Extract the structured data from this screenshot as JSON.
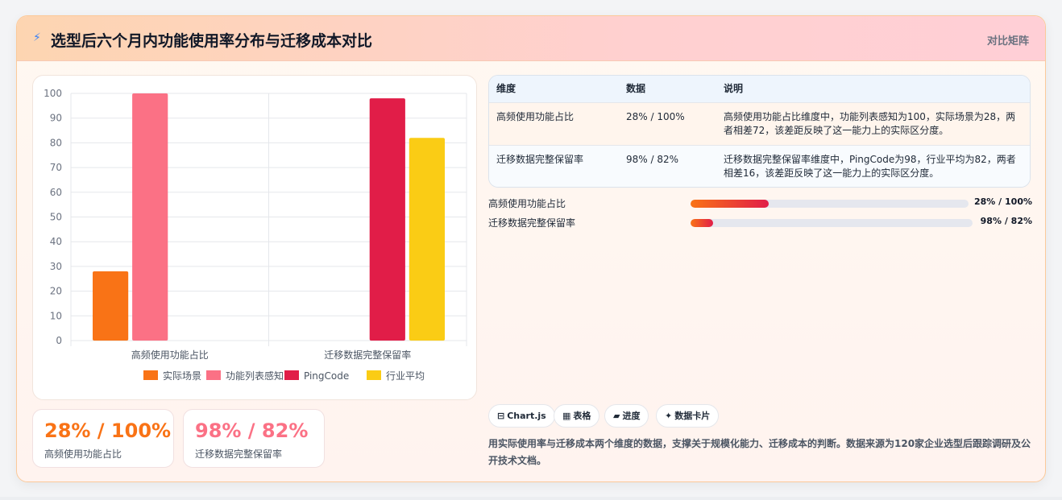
{
  "header": {
    "icon": "bolt-icon",
    "title": "选型后六个月内功能使用率分布与迁移成本对比",
    "tag": "对比矩阵"
  },
  "chart_data": {
    "type": "bar",
    "categories": [
      "高频使用功能占比",
      "迁移数据完整保留率"
    ],
    "series": [
      {
        "name": "实际场景",
        "color": "#f97316",
        "values": [
          28,
          null
        ]
      },
      {
        "name": "功能列表感知",
        "color": "#fb7185",
        "values": [
          100,
          null
        ]
      },
      {
        "name": "PingCode",
        "color": "#e11d48",
        "values": [
          null,
          98
        ]
      },
      {
        "name": "行业平均",
        "color": "#facc15",
        "values": [
          null,
          82
        ]
      }
    ],
    "yticks": [
      0,
      10,
      20,
      30,
      40,
      50,
      60,
      70,
      80,
      90,
      100
    ],
    "ylim": [
      0,
      100
    ],
    "grid": true,
    "legend": "bottom"
  },
  "stats": [
    {
      "value": "28% / 100%",
      "label": "高频使用功能占比",
      "color": "#f97316"
    },
    {
      "value": "98% / 82%",
      "label": "迁移数据完整保留率",
      "color": "#fb7185"
    }
  ],
  "table": {
    "headers": [
      "维度",
      "数据",
      "说明"
    ],
    "rows": [
      [
        "高频使用功能占比",
        "28% / 100%",
        "高频使用功能占比维度中，功能列表感知为100，实际场景为28，两者相差72，该差距反映了这一能力上的实际区分度。"
      ],
      [
        "迁移数据完整保留率",
        "98% / 82%",
        "迁移数据完整保留率维度中，PingCode为98，行业平均为82，两者相差16，该差距反映了这一能力上的实际区分度。"
      ]
    ]
  },
  "progress": [
    {
      "label": "高频使用功能占比",
      "value": "28% / 100%",
      "fraction": 0.28
    },
    {
      "label": "迁移数据完整保留率",
      "value": "98% / 82%",
      "fraction": 0.08
    }
  ],
  "chips": [
    {
      "icon": "⊟",
      "label": "Chart.js"
    },
    {
      "icon": "▦",
      "label": "表格"
    },
    {
      "icon": "▰",
      "label": "进度"
    },
    {
      "icon": "✦",
      "label": "数据卡片"
    }
  ],
  "description": "用实际使用率与迁移成本两个维度的数据，支撑关于规模化能力、迁移成本的判断。数据来源为120家企业选型后跟踪调研及公开技术文档。"
}
